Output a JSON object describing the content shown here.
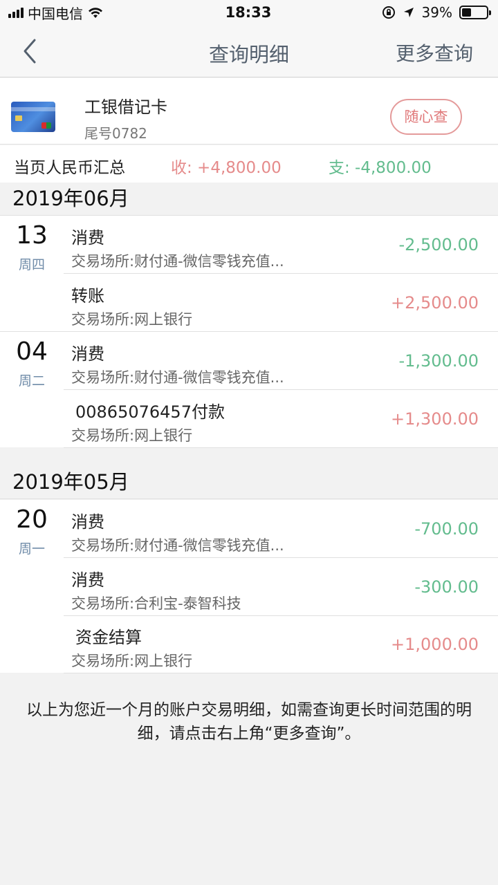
{
  "status_bar": {
    "carrier": "中国电信",
    "time": "18:33",
    "battery_text": "39%",
    "battery_level": 0.39
  },
  "nav": {
    "title": "查询明细",
    "more": "更多查询"
  },
  "card": {
    "name": "工银借记卡",
    "tail": "尾号0782",
    "button": "随心查"
  },
  "summary": {
    "label": "当页人民币汇总",
    "income": "收: +4,800.00",
    "expense": "支: -4,800.00"
  },
  "months": [
    {
      "label": "2019年06月",
      "days": [
        {
          "day": "13",
          "weekday": "周四",
          "txns": [
            {
              "title": "消费",
              "sub": "交易场所:财付通-微信零钱充值...",
              "amount": "-2,500.00"
            },
            {
              "title": "转账",
              "sub": "交易场所:网上银行",
              "amount": "+2,500.00"
            }
          ]
        },
        {
          "day": "04",
          "weekday": "周二",
          "txns": [
            {
              "title": "消费",
              "sub": "交易场所:财付通-微信零钱充值...",
              "amount": "-1,300.00"
            },
            {
              "title": "00865076457付款",
              "sub": "交易场所:网上银行",
              "amount": "+1,300.00"
            }
          ]
        }
      ]
    },
    {
      "label": "2019年05月",
      "days": [
        {
          "day": "20",
          "weekday": "周一",
          "txns": [
            {
              "title": "消费",
              "sub": "交易场所:财付通-微信零钱充值...",
              "amount": "-700.00"
            },
            {
              "title": "消费",
              "sub": "交易场所:合利宝-泰智科技",
              "amount": "-300.00"
            },
            {
              "title": "资金结算",
              "sub": "交易场所:网上银行",
              "amount": "+1,000.00"
            }
          ]
        }
      ]
    }
  ],
  "footer_note": "以上为您近一个月的账户交易明细，如需查询更长时间范围的明细，请点击右上角“更多查询”。",
  "colors": {
    "expense": "#63bc8e",
    "income": "#e58b8b",
    "nav_text": "#54606e"
  },
  "icons": [
    "signal-icon",
    "wifi-icon",
    "orientation-lock-icon",
    "location-icon",
    "battery-icon",
    "back-chevron-icon",
    "bank-card-icon"
  ]
}
